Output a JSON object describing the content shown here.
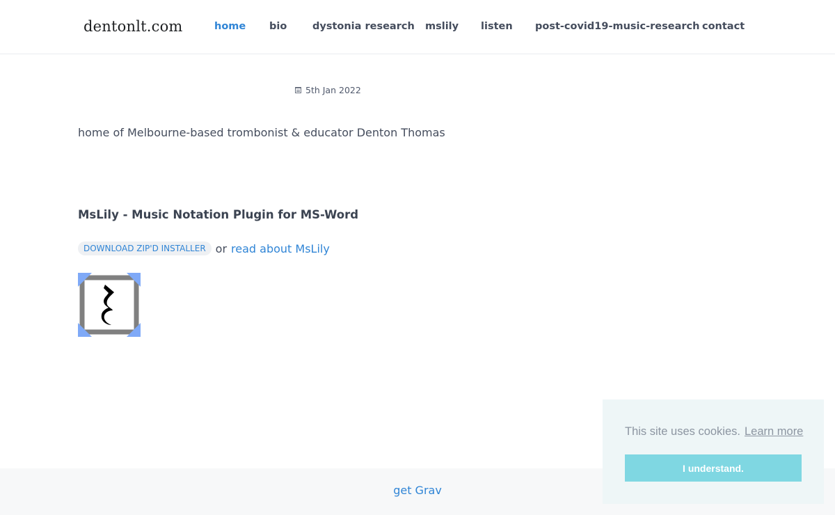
{
  "header": {
    "logo": "dentonlt.com",
    "nav": [
      {
        "label": "home",
        "active": true
      },
      {
        "label": "bio"
      },
      {
        "label": "dystonia research"
      },
      {
        "label": "mslily"
      },
      {
        "label": "listen"
      },
      {
        "label": "post-covid19-music-research"
      },
      {
        "label": "contact"
      }
    ]
  },
  "main": {
    "date": "5th Jan 2022",
    "intro": "home of Melbourne-based trombonist & educator Denton Thomas",
    "section_title": "MsLily - Music Notation Plugin for MS-Word",
    "download_label": "DOWNLOAD ZIP'D INSTALLER",
    "or_text": "or",
    "read_link": "read about MsLily"
  },
  "footer": {
    "link": "get Grav"
  },
  "cookie": {
    "message": "This site uses cookies.",
    "learn_more": "Learn more",
    "accept": "I understand."
  },
  "colors": {
    "accent": "#3085d6",
    "cookie_button": "#7fd7e2",
    "logo_corner": "#7fa9f7"
  }
}
